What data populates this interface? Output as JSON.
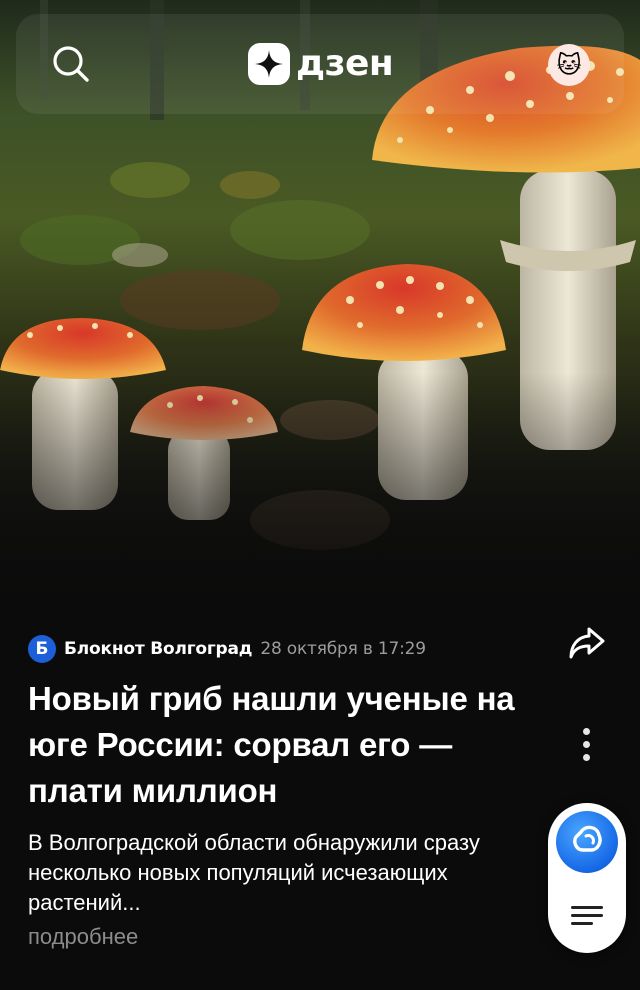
{
  "app": {
    "logo_text": "дзен"
  },
  "icons": {
    "search": "search-icon",
    "logo": "dzen-star-icon",
    "avatar": "cat-emoji-avatar",
    "share": "share-arrow-icon",
    "more": "vertical-dots-icon",
    "assistant": "alice-assistant-icon",
    "menu": "hamburger-menu-icon"
  },
  "header": {
    "avatar_glyph": "🐱"
  },
  "article": {
    "source_logo_letter": "Б",
    "source_name": "Блокнот Волгоград",
    "date": "28 октября в 17:29",
    "title": "Новый гриб нашли ученые на юге России: сорвал его — плати миллион",
    "description": "В Волгоградской области обнаружили сразу несколько новых популяций исчезающих растений...",
    "read_more": "подробнее"
  },
  "colors": {
    "background": "#0b0b0b",
    "source_logo": "#1d5fd8",
    "assistant": "#1668e6",
    "secondary_text": "#9c9c9c"
  }
}
